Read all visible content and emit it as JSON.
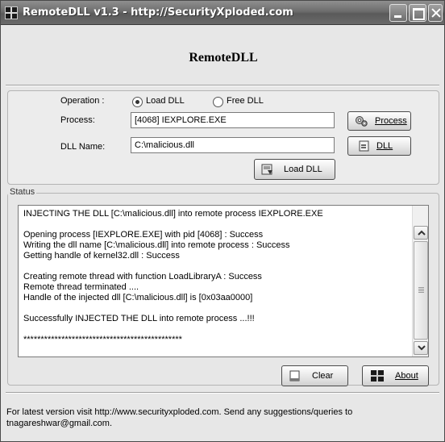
{
  "window": {
    "title": "RemoteDLL v1.3 - http://SecurityXploded.com"
  },
  "header": {
    "title": "RemoteDLL"
  },
  "operation": {
    "label": "Operation :",
    "options": [
      {
        "label": "Load DLL",
        "selected": true
      },
      {
        "label": "Free DLL",
        "selected": false
      }
    ]
  },
  "process": {
    "label": "Process:",
    "value": "[4068] IEXPLORE.EXE",
    "button_label": "Process"
  },
  "dll": {
    "label": "DLL Name:",
    "value": "C:\\malicious.dll",
    "browse_label": "DLL",
    "load_label": "Load DLL"
  },
  "status": {
    "legend": "Status",
    "lines": [
      "INJECTING THE DLL [C:\\malicious.dll] into remote process IEXPLORE.EXE",
      "",
      "Opening process [IEXPLORE.EXE] with pid [4068]  :   Success",
      "Writing the dll name [C:\\malicious.dll] into remote process :  Success",
      "Getting handle of kernel32.dll :  Success",
      "",
      "Creating remote thread with function LoadLibraryA :  Success",
      "Remote thread terminated ....",
      "Handle of the injected dll [C:\\malicious.dll] is [0x03aa0000]",
      "",
      "Successfully INJECTED THE DLL into remote process ...!!!",
      "",
      "**********************************************"
    ]
  },
  "buttons": {
    "clear": "Clear",
    "about": "About"
  },
  "footer": {
    "line1": "For latest version visit http://www.securityxploded.com. Send any suggestions/queries to",
    "line2": "tnagareshwar@gmail.com."
  },
  "icons": {
    "app": "app-grid-icon",
    "process": "process-gears-icon",
    "dll": "dll-file-icon",
    "load": "load-dll-icon",
    "clear": "clear-page-icon",
    "about": "about-grid-icon"
  }
}
